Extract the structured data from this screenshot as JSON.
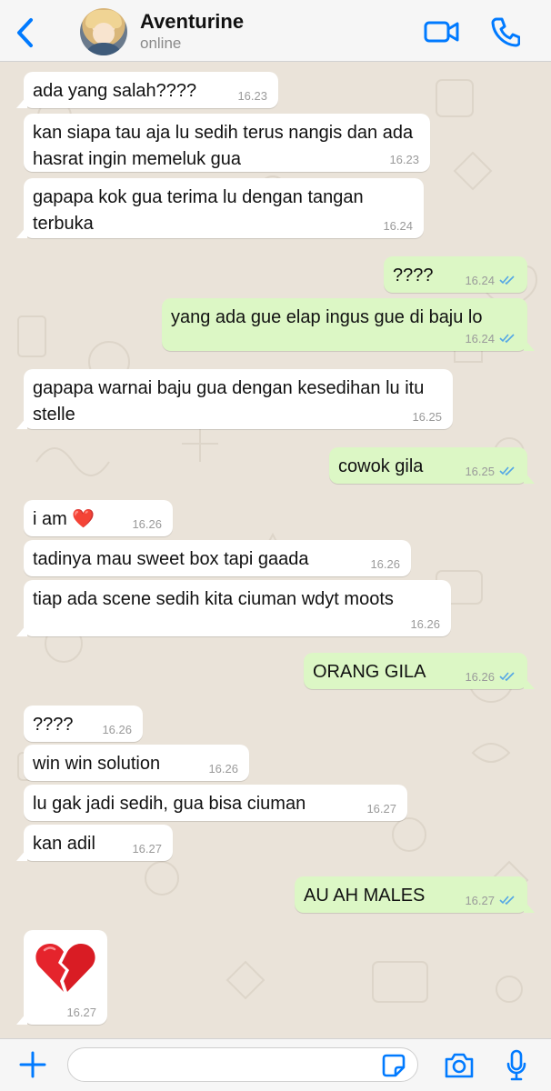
{
  "header": {
    "contact_name": "Aventurine",
    "status": "online"
  },
  "composer": {
    "placeholder": ""
  },
  "colors": {
    "accent": "#007aff",
    "incoming_bubble": "#ffffff",
    "outgoing_bubble": "#dcf7c5",
    "read_ticks": "#53a6e6"
  },
  "messages": [
    {
      "dir": "in",
      "text": "ada yang salah????",
      "time": "16.23"
    },
    {
      "dir": "in",
      "text": "kan siapa tau aja lu sedih terus nangis dan ada hasrat ingin memeluk gua",
      "time": "16.23"
    },
    {
      "dir": "in",
      "text": "gapapa kok gua terima lu dengan tangan terbuka",
      "time": "16.24"
    },
    {
      "dir": "out",
      "text": "????",
      "time": "16.24",
      "read": true
    },
    {
      "dir": "out",
      "text": "yang ada gue elap ingus gue di baju lo",
      "time": "16.24",
      "read": true
    },
    {
      "dir": "in",
      "text": "gapapa warnai baju gua dengan kesedihan lu itu stelle",
      "time": "16.25"
    },
    {
      "dir": "out",
      "text": "cowok gila",
      "time": "16.25",
      "read": true
    },
    {
      "dir": "in",
      "text": "i am ❤️",
      "time": "16.26"
    },
    {
      "dir": "in",
      "text": "tadinya mau sweet box tapi gaada",
      "time": "16.26"
    },
    {
      "dir": "in",
      "text": "tiap ada scene sedih kita ciuman wdyt moots",
      "time": "16.26"
    },
    {
      "dir": "out",
      "text": "ORANG GILA",
      "time": "16.26",
      "read": true
    },
    {
      "dir": "in",
      "text": "????",
      "time": "16.26"
    },
    {
      "dir": "in",
      "text": "win win solution",
      "time": "16.26"
    },
    {
      "dir": "in",
      "text": "lu gak jadi sedih, gua bisa ciuman",
      "time": "16.27"
    },
    {
      "dir": "in",
      "text": "kan adil",
      "time": "16.27"
    },
    {
      "dir": "out",
      "text": "AU AH MALES",
      "time": "16.27",
      "read": true
    },
    {
      "dir": "in",
      "text": "💔",
      "time": "16.27",
      "icon": "broken-heart-icon"
    }
  ]
}
